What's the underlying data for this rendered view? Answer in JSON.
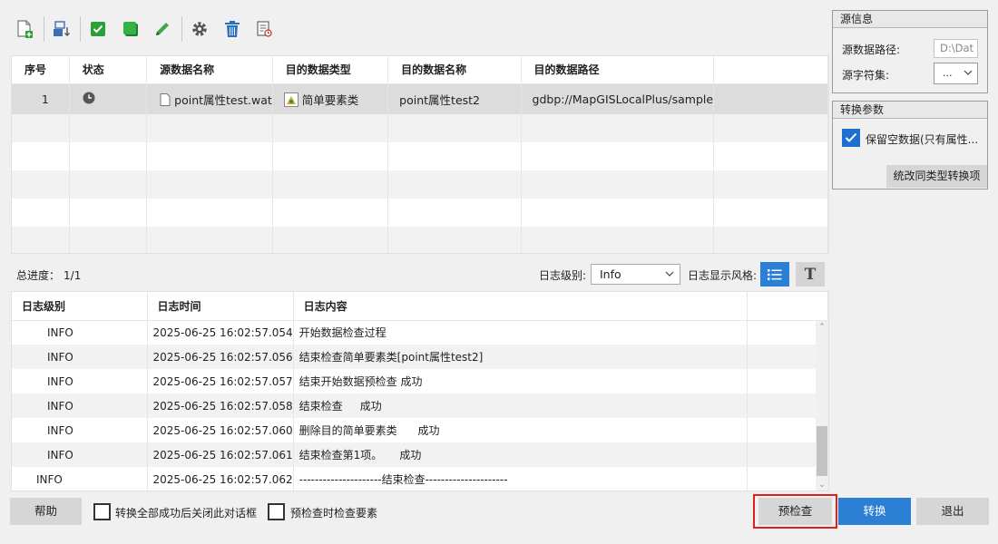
{
  "colors": {
    "accent": "#2b7fd4",
    "highlight": "#e02020"
  },
  "toolbar": {
    "icons": [
      "add-file-icon",
      "import-icon",
      "check-all-icon",
      "select-icon",
      "edit-icon",
      "settings-icon",
      "delete-icon",
      "log-icon"
    ]
  },
  "main_table": {
    "headers": [
      "序号",
      "状态",
      "源数据名称",
      "目的数据类型",
      "目的数据名称",
      "目的数据路径"
    ],
    "rows": [
      {
        "index": "1",
        "status_icon": "clock-icon",
        "source_name": "point属性test.wat",
        "dest_type": "简单要素类",
        "dest_name": "point属性test2",
        "dest_path": "gdbp://MapGISLocalPlus/sample"
      }
    ]
  },
  "progress": {
    "label": "总进度：",
    "value": "1/1"
  },
  "log_controls": {
    "level_label": "日志级别:",
    "level_value": "Info",
    "style_label": "日志显示风格:",
    "text_style_glyph": "T"
  },
  "log_table": {
    "headers": [
      "日志级别",
      "日志时间",
      "日志内容"
    ],
    "rows": [
      {
        "level": "INFO",
        "time": "2025-06-25 16:02:57.054",
        "content": "开始数据检查过程"
      },
      {
        "level": "INFO",
        "time": "2025-06-25 16:02:57.056",
        "content": "结束检查简单要素类[point属性test2]"
      },
      {
        "level": "INFO",
        "time": "2025-06-25 16:02:57.057",
        "content": "结束开始数据预检查 成功"
      },
      {
        "level": "INFO",
        "time": "2025-06-25 16:02:57.058",
        "content": "结束检查     成功"
      },
      {
        "level": "INFO",
        "time": "2025-06-25 16:02:57.060",
        "content": "删除目的简单要素类      成功"
      },
      {
        "level": "INFO",
        "time": "2025-06-25 16:02:57.061",
        "content": "结束检查第1项。     成功"
      },
      {
        "level": "INFO",
        "time": "2025-06-25 16:02:57.062",
        "content": "---------------------结束检查---------------------"
      }
    ]
  },
  "source_panel": {
    "title": "源信息",
    "path_label": "源数据路径:",
    "path_value": "D:\\Dat",
    "charset_label": "源字符集:",
    "charset_value": "..."
  },
  "convert_panel": {
    "title": "转换参数",
    "keep_empty_label": "保留空数据(只有属性...",
    "unify_button": "统改同类型转换项"
  },
  "bottom": {
    "help": "帮助",
    "close_after_label": "转换全部成功后关闭此对话框",
    "precheck_features_label": "预检查时检查要素",
    "precheck": "预检查",
    "convert": "转换",
    "exit": "退出"
  }
}
